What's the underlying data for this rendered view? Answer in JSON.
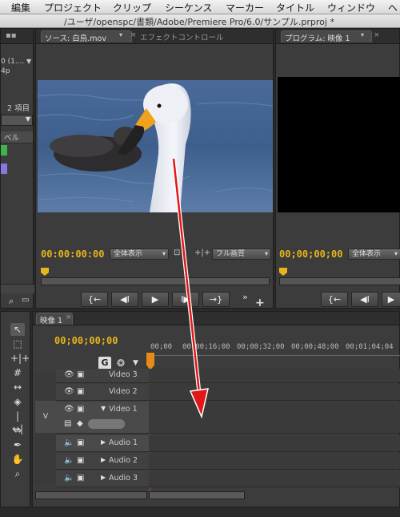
{
  "menu": [
    "編集",
    "プロジェクト",
    "クリップ",
    "シーケンス",
    "マーカー",
    "タイトル",
    "ウィンドウ",
    "ヘ"
  ],
  "window_title": "/ユーザ/openspc/書類/Adobe/Premiere Pro/6.0/サンプル.prproj *",
  "project_panel": {
    "info1": "0 (1....",
    "info2": "4p",
    "items_count": "2 項目",
    "column_label": "ベル"
  },
  "source_monitor": {
    "tab_source": "ソース: 白鳥.mov",
    "tab_effect": "エフェクトコントロール",
    "timecode": "00:00:00:00",
    "zoom": "全体表示",
    "quality": "フル画質"
  },
  "program_monitor": {
    "tab": "プログラム: 映像 1",
    "timecode": "00;00;00;00",
    "zoom": "全体表示"
  },
  "transport_buttons": [
    "{←",
    "◀I",
    "▶",
    "I▶",
    "→}"
  ],
  "extras_label": "»",
  "timeline": {
    "tab": "映像 1",
    "timecode": "00;00;00;00",
    "ruler": [
      "00;00",
      "00;00;16;00",
      "00;00;32;00",
      "00;00;48;00",
      "00;01;04;04"
    ],
    "tracks": [
      {
        "name": "Video 3",
        "type": "video"
      },
      {
        "name": "Video 2",
        "type": "video"
      },
      {
        "name": "Video 1",
        "type": "video"
      },
      {
        "name": "Audio 1",
        "type": "audio"
      },
      {
        "name": "Audio 2",
        "type": "audio"
      },
      {
        "name": "Audio 3",
        "type": "audio"
      }
    ],
    "target_video": "V"
  },
  "colors": {
    "timecode": "#e8b61a",
    "arrow": "#e01818",
    "label_green": "#3fb34f",
    "label_purple": "#8a78e0"
  }
}
